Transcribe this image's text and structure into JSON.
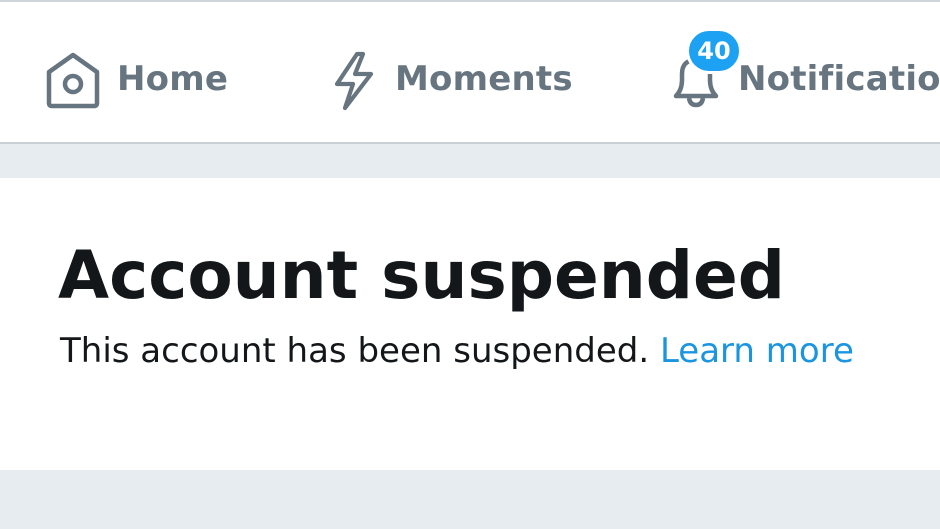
{
  "nav": {
    "home": {
      "label": "Home",
      "icon": "home-icon"
    },
    "moments": {
      "label": "Moments",
      "icon": "lightning-icon"
    },
    "notifications": {
      "label": "Notifications",
      "icon": "bell-icon",
      "badge": "40"
    }
  },
  "card": {
    "title": "Account suspended",
    "message": "This account has been suspended.",
    "learn_more": "Learn more"
  },
  "colors": {
    "accent": "#1da1f2",
    "link": "#1b95e0",
    "nav_text": "#66757f",
    "background": "#e6ecf0"
  }
}
